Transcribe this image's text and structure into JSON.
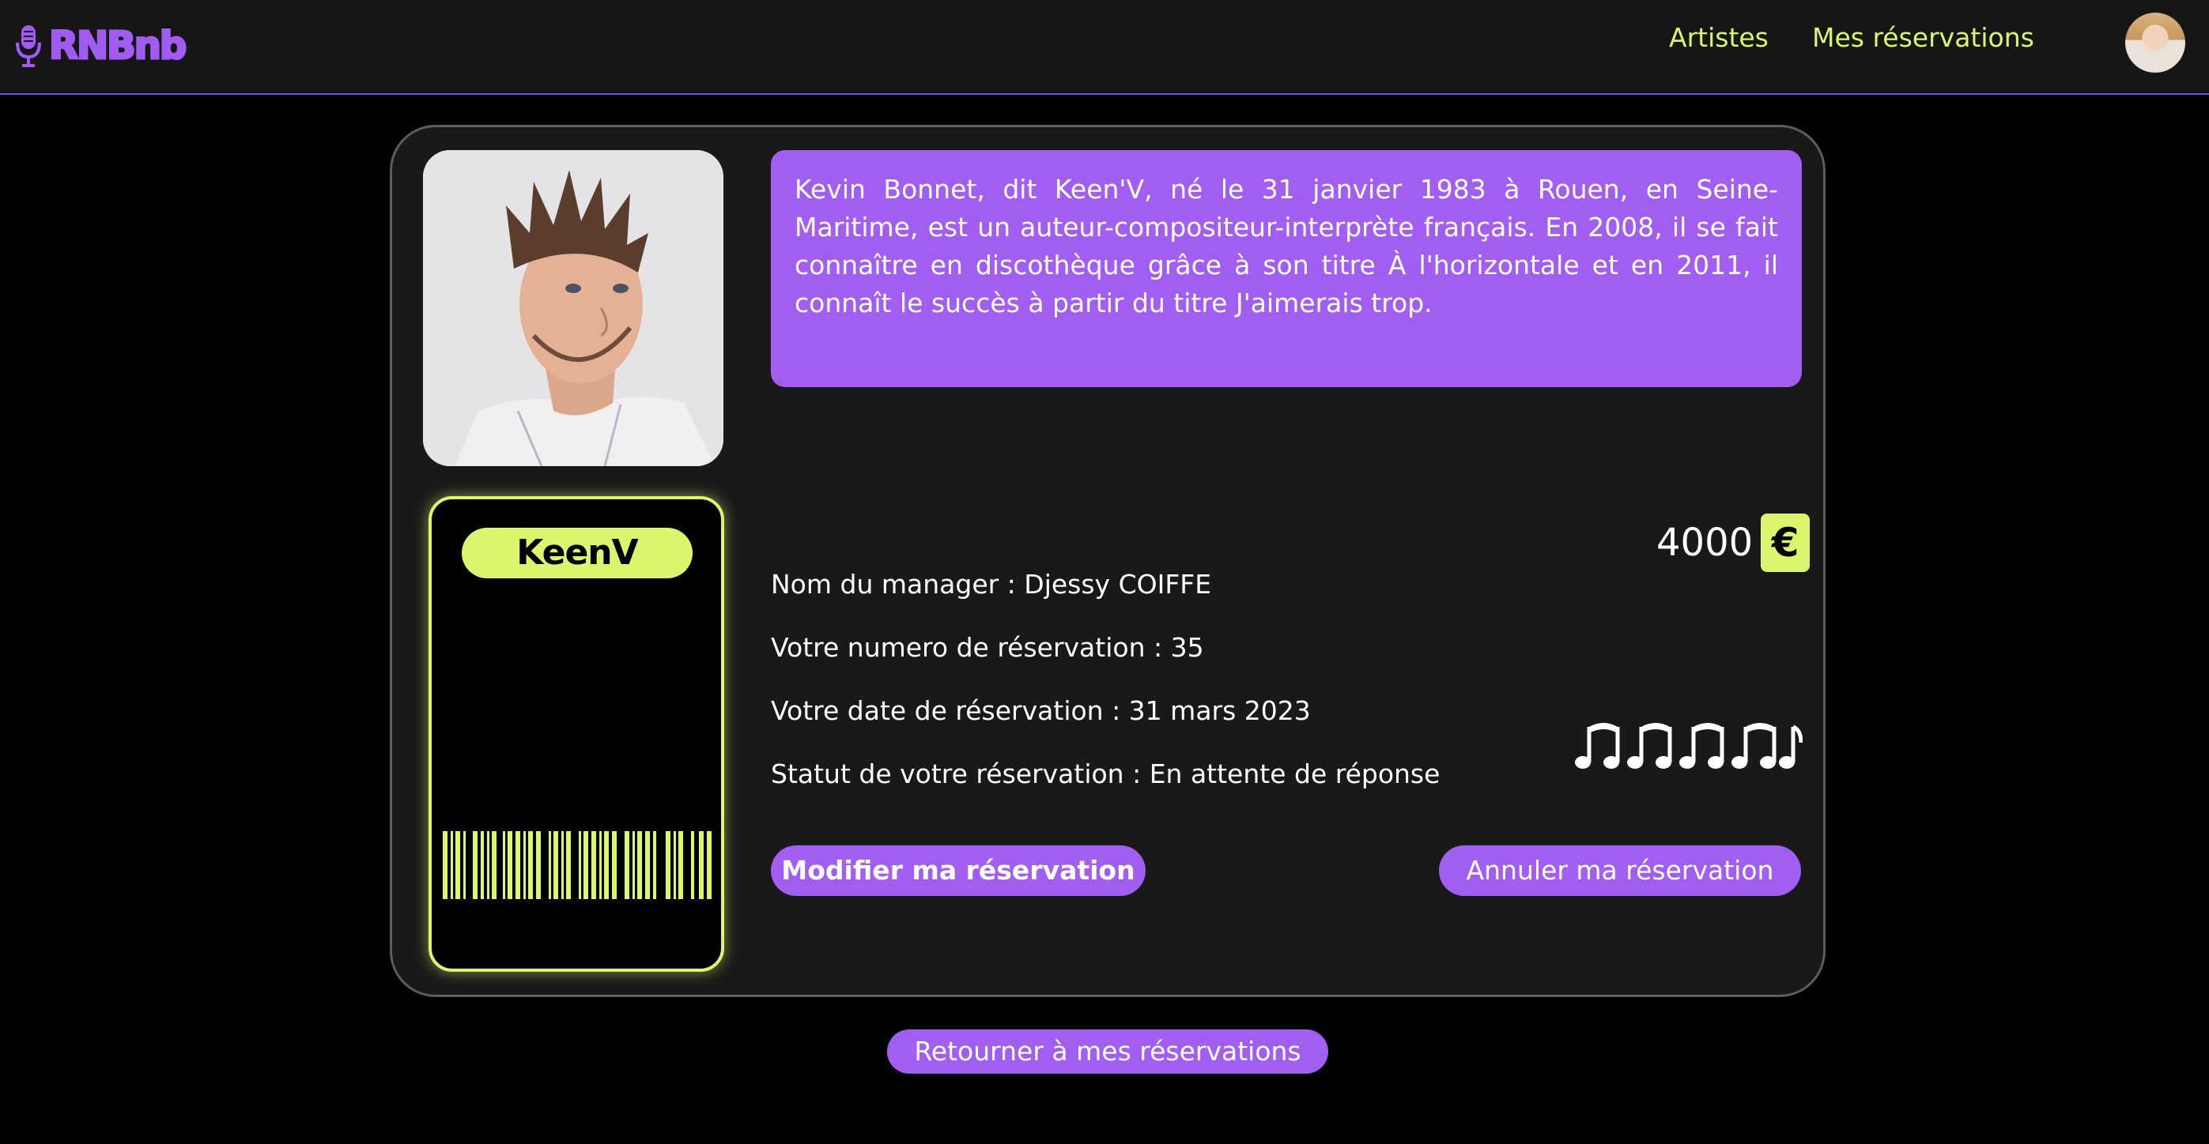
{
  "brand": {
    "name": "RNBnb"
  },
  "nav": {
    "artistes": "Artistes",
    "reservations": "Mes réservations"
  },
  "colors": {
    "accent_purple": "#a15ef1",
    "accent_lime": "#dcf56e",
    "background": "#000000",
    "card": "#191919"
  },
  "artist": {
    "ticket_name": "KeenV",
    "bio": "Kevin Bonnet, dit Keen'V, né le 31 janvier 1983 à Rouen, en Seine-Maritime, est un auteur-compositeur-interprète français. En 2008, il se fait connaître en discothèque grâce à son titre À l'horizontale et en 2011, il connaît le succès à partir du titre J'aimerais trop."
  },
  "reservation": {
    "price": "4000",
    "currency": "€",
    "manager": "Nom du manager : Djessy COIFFE",
    "number": "Votre numero de réservation : 35",
    "date": "Votre date de réservation : 31 mars 2023",
    "status": "Statut de votre réservation : En attente de réponse"
  },
  "actions": {
    "modify": "Modifier ma réservation",
    "cancel": "Annuler ma réservation",
    "back": "Retourner à mes réservations"
  },
  "icons": [
    "microphone-icon",
    "euro-icon",
    "music-notes-icon",
    "barcode-icon"
  ]
}
